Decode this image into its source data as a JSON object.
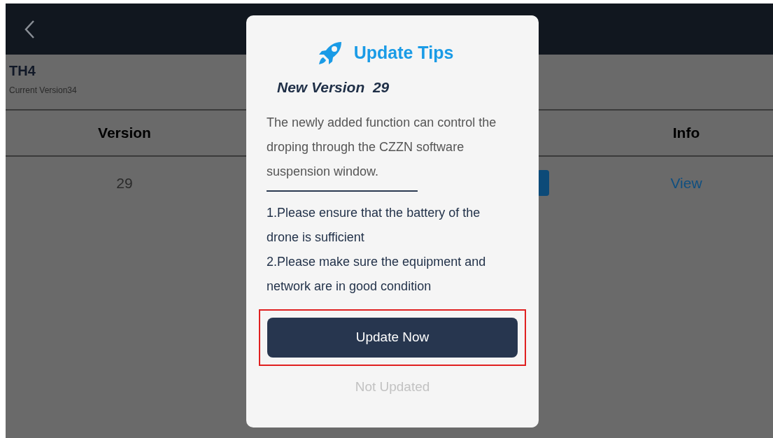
{
  "device": {
    "name": "TH4",
    "current_version": "Current Version34"
  },
  "table": {
    "columns": [
      {
        "label": "Version",
        "kind": "left"
      },
      {
        "label": "Info",
        "kind": "right"
      }
    ],
    "rows": [
      {
        "version": "29",
        "info": "View"
      }
    ]
  },
  "dialog": {
    "title": "Update Tips",
    "new_version": "New Version  29",
    "description": "The newly added function can control the droping through the CZZN software suspension window.",
    "notes": [
      "1.Please ensure that the battery of the drone is sufficient",
      "2.Please make sure the equipment and network are in good condition"
    ],
    "primary_button": "Update Now",
    "highlighted": true,
    "secondary_button": "Not Updated"
  }
}
